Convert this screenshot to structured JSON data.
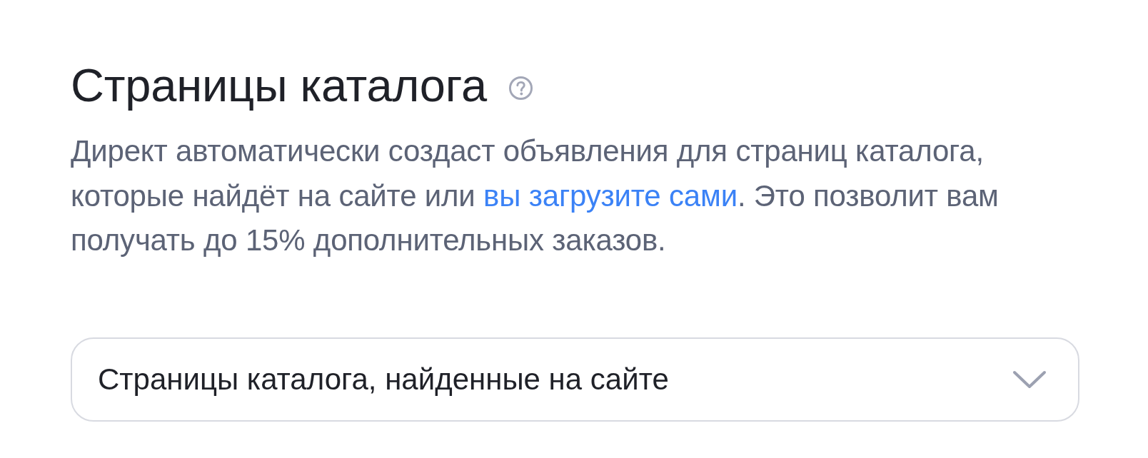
{
  "section": {
    "title": "Страницы каталога",
    "description_before": "Директ автоматически создаст объявления для страниц каталога, которые найдёт на сайте или ",
    "link": "вы загрузите сами",
    "description_after": ". Это позволит вам получать до 15% дополнительных заказов."
  },
  "dropdown": {
    "value": "Страницы каталога, найденные на сайте"
  }
}
